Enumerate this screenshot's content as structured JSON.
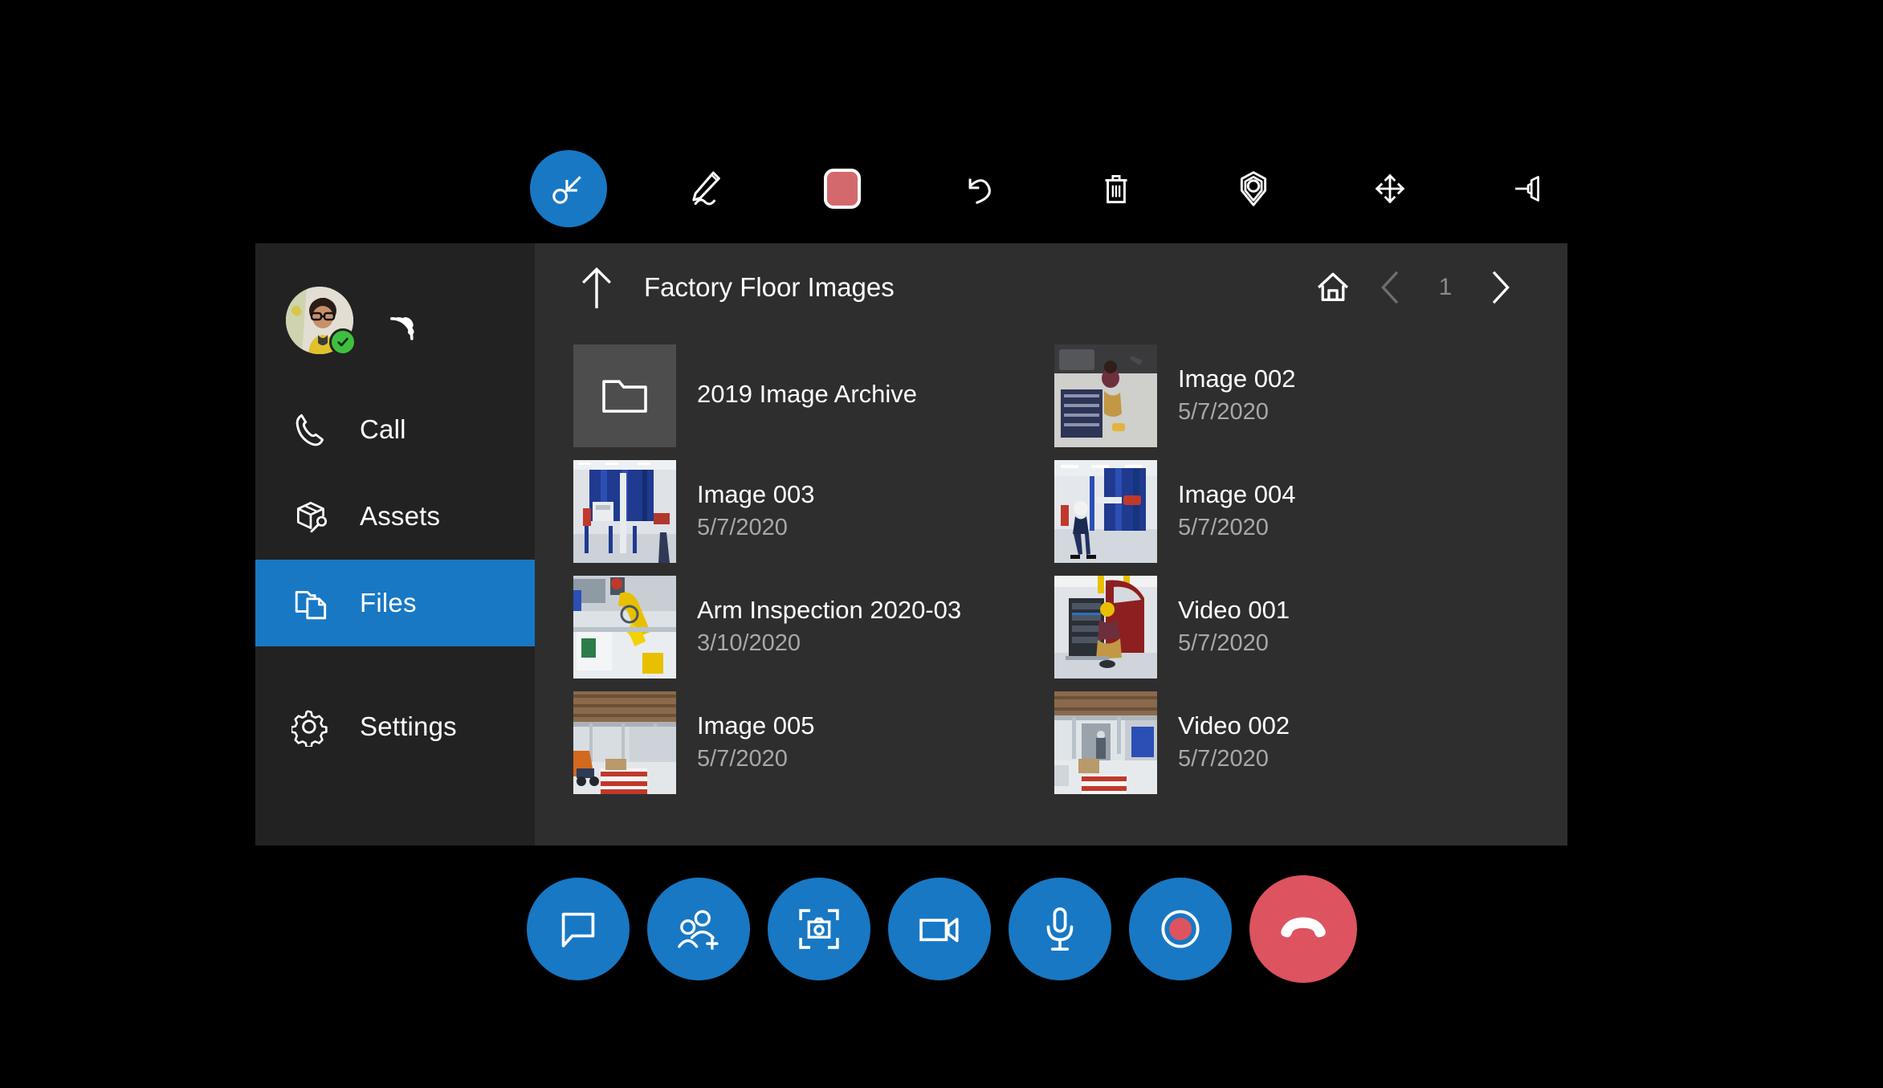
{
  "theme": {
    "accent_blue": "#1878c4",
    "danger_red": "#dd5360",
    "panel_bg": "#2e2e2e",
    "sidebar_bg": "#222222",
    "ink_color_swatch": "#d4696d",
    "presence_green": "#3fbf3f",
    "text_primary": "#ffffff",
    "text_secondary": "#a8a8a8"
  },
  "top_toolbar": {
    "items": [
      {
        "name": "select-tool",
        "icon": "cursor-select-icon",
        "active": true
      },
      {
        "name": "ink-pen-tool",
        "icon": "pen-icon",
        "active": false
      },
      {
        "name": "ink-color-swatch",
        "icon": "color-swatch-icon",
        "active": false
      },
      {
        "name": "undo",
        "icon": "undo-icon",
        "active": false
      },
      {
        "name": "delete",
        "icon": "trash-icon",
        "active": false
      },
      {
        "name": "place-anchor",
        "icon": "anchor-pin-icon",
        "active": false
      },
      {
        "name": "move",
        "icon": "move-arrows-icon",
        "active": false
      },
      {
        "name": "pin-panel",
        "icon": "pushpin-icon",
        "active": false
      }
    ]
  },
  "sidebar": {
    "profile": {
      "avatar_alt": "User avatar",
      "presence": "available",
      "presence_icon": "checkmark-icon",
      "connection_icon": "wifi-signal-icon"
    },
    "items": [
      {
        "label": "Call",
        "icon": "phone-icon",
        "active": false
      },
      {
        "label": "Assets",
        "icon": "box-wrench-icon",
        "active": false
      },
      {
        "label": "Files",
        "icon": "files-folder-icon",
        "active": true
      },
      {
        "label": "Settings",
        "icon": "gear-icon",
        "active": false
      }
    ]
  },
  "content": {
    "header": {
      "up_icon": "arrow-up-icon",
      "breadcrumb": "Factory Floor Images",
      "home_icon": "home-icon",
      "prev_icon": "chevron-left-icon",
      "next_icon": "chevron-right-icon",
      "page_number": "1"
    },
    "files": [
      {
        "name": "2019 Image Archive",
        "date": "",
        "kind": "folder",
        "thumb": "folder"
      },
      {
        "name": "Image 002",
        "date": "5/7/2020",
        "kind": "image",
        "thumb": "tech-toolbox"
      },
      {
        "name": "Image 003",
        "date": "5/7/2020",
        "kind": "image",
        "thumb": "blue-tanks"
      },
      {
        "name": "Image 004",
        "date": "5/7/2020",
        "kind": "image",
        "thumb": "walking-worker"
      },
      {
        "name": "Arm Inspection 2020-03",
        "date": "3/10/2020",
        "kind": "image",
        "thumb": "yellow-robot-arm"
      },
      {
        "name": "Video 001",
        "date": "5/7/2020",
        "kind": "video",
        "thumb": "red-vehicle"
      },
      {
        "name": "Image 005",
        "date": "5/7/2020",
        "kind": "image",
        "thumb": "warehouse-pallets"
      },
      {
        "name": "Video 002",
        "date": "5/7/2020",
        "kind": "video",
        "thumb": "warehouse-aisle"
      }
    ]
  },
  "bottom_bar": {
    "buttons": [
      {
        "name": "chat-button",
        "icon": "chat-bubble-icon",
        "style": "primary"
      },
      {
        "name": "add-person-button",
        "icon": "add-person-icon",
        "style": "primary"
      },
      {
        "name": "capture-photo-button",
        "icon": "camera-icon",
        "style": "primary"
      },
      {
        "name": "video-toggle-button",
        "icon": "video-camera-icon",
        "style": "primary"
      },
      {
        "name": "mute-button",
        "icon": "microphone-icon",
        "style": "primary"
      },
      {
        "name": "record-button",
        "icon": "record-icon",
        "style": "primary"
      },
      {
        "name": "end-call-button",
        "icon": "end-call-icon",
        "style": "danger"
      }
    ]
  }
}
